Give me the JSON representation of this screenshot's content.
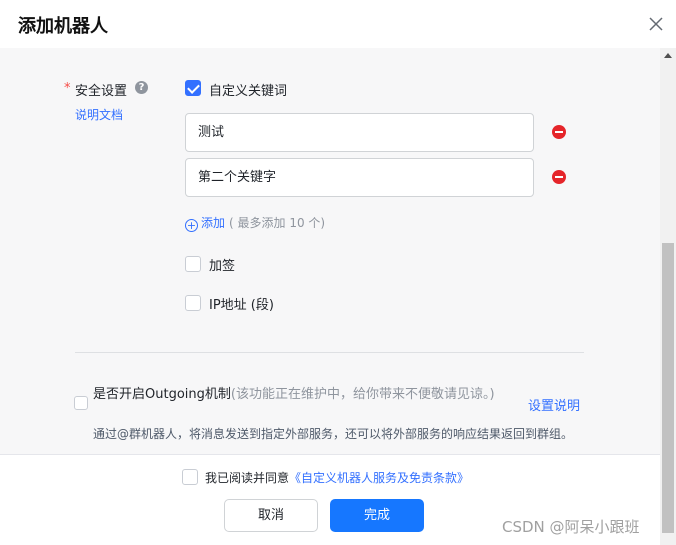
{
  "dialog": {
    "title": "添加机器人"
  },
  "security": {
    "required_mark": "*",
    "label": "安全设置",
    "help_glyph": "?",
    "doc_link": "说明文档",
    "custom_keyword_label": "自定义关键词",
    "custom_keyword_checked": true,
    "keywords": [
      "测试",
      "第二个关键字"
    ],
    "add_glyph": "+",
    "add_label": "添加",
    "add_hint": "( 最多添加 10 个)",
    "sign_label": "加签",
    "sign_checked": false,
    "ip_label": "IP地址 (段)",
    "ip_checked": false
  },
  "outgoing": {
    "title": "是否开启Outgoing机制",
    "note": "(该功能正在维护中，给你带来不便敬请见谅。)",
    "setup_link": "设置说明",
    "description": "通过@群机器人，将消息发送到指定外部服务，还可以将外部服务的响应结果返回到群组。",
    "checked": false
  },
  "footer": {
    "agree_text": "我已阅读并同意",
    "agree_link": "《自定义机器人服务及免责条款》",
    "agree_checked": false,
    "cancel_label": "取消",
    "confirm_label": "完成"
  },
  "watermark": "CSDN @阿呆小跟班",
  "colors": {
    "accent": "#3370ff",
    "primary_button": "#1677ff",
    "danger": "#e5252a",
    "required": "#f54a45"
  }
}
